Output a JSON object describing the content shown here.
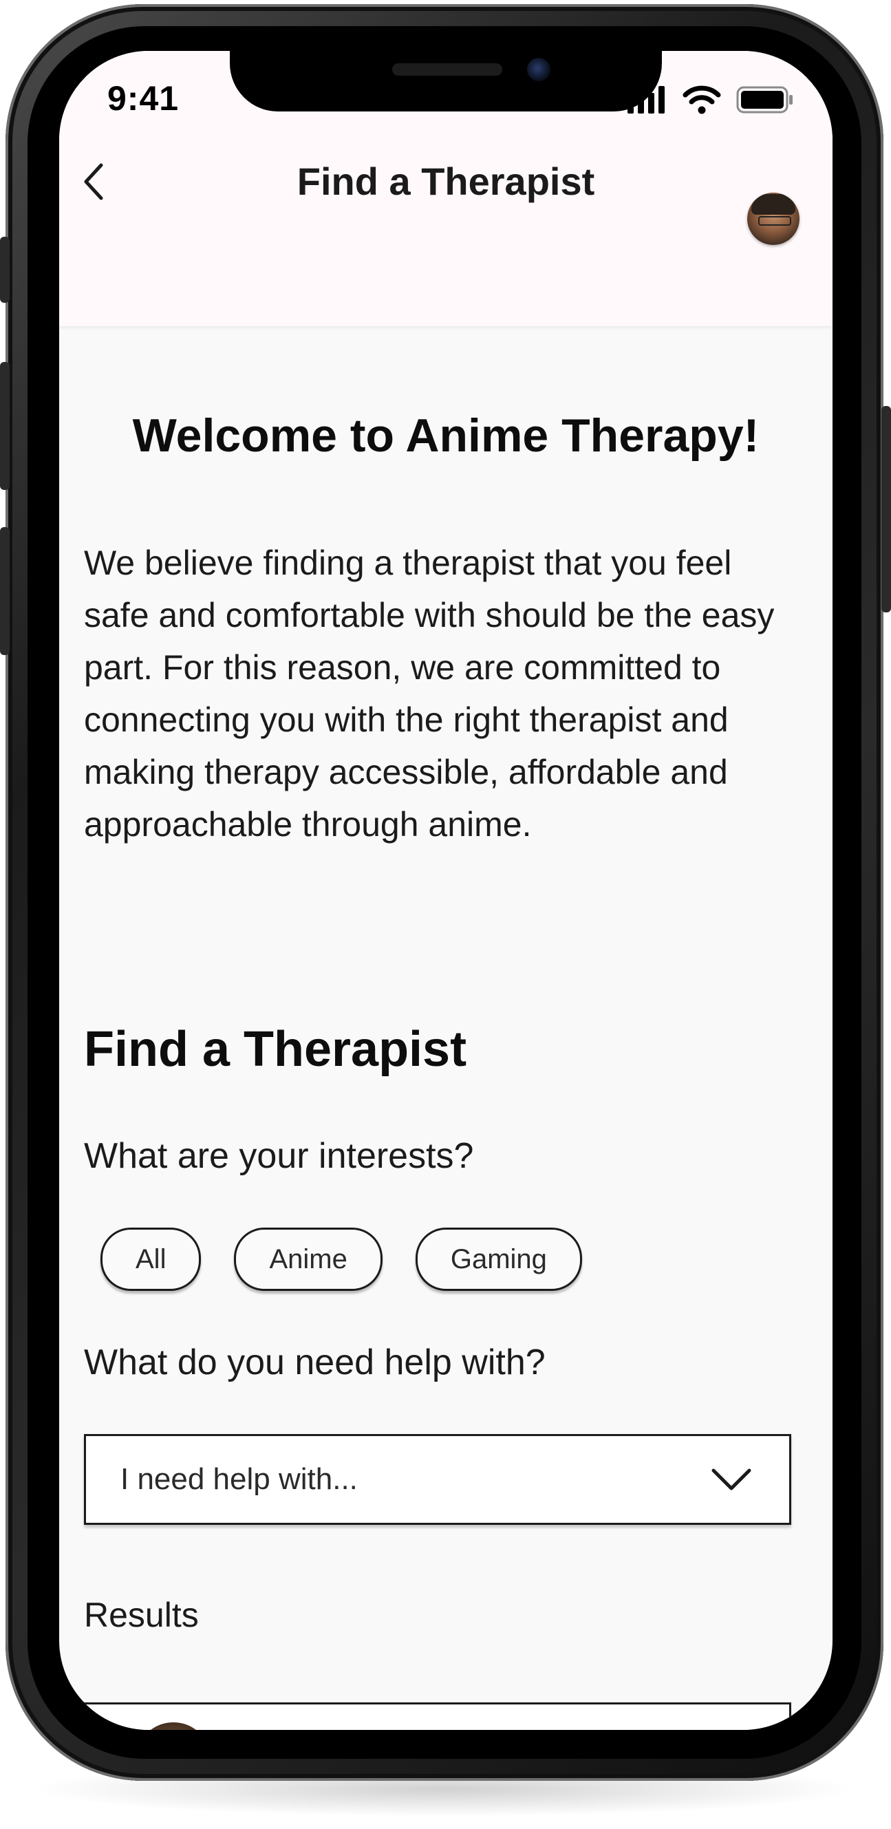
{
  "status_bar": {
    "time": "9:41"
  },
  "header": {
    "title": "Find a Therapist",
    "back_icon": "chevron-left-icon",
    "avatar": "user-avatar"
  },
  "welcome": {
    "title": "Welcome to Anime Therapy!",
    "intro": "We believe finding a therapist that you feel safe and comfortable with should be the easy part. For this reason, we are committed to connecting you with the right therapist and making therapy accessible, affordable and approachable through anime."
  },
  "finder": {
    "section_title": "Find a Therapist",
    "interests_question": "What are your interests?",
    "chips": [
      {
        "label": "All"
      },
      {
        "label": "Anime"
      },
      {
        "label": "Gaming"
      }
    ],
    "help_question": "What do you need help with?",
    "help_select": {
      "value": "I need help with...",
      "icon": "chevron-down-icon"
    },
    "results_label": "Results"
  },
  "colors": {
    "header_bg": "#fff9fb",
    "screen_bg": "#f9f9f9",
    "text": "#1b1b1b"
  }
}
